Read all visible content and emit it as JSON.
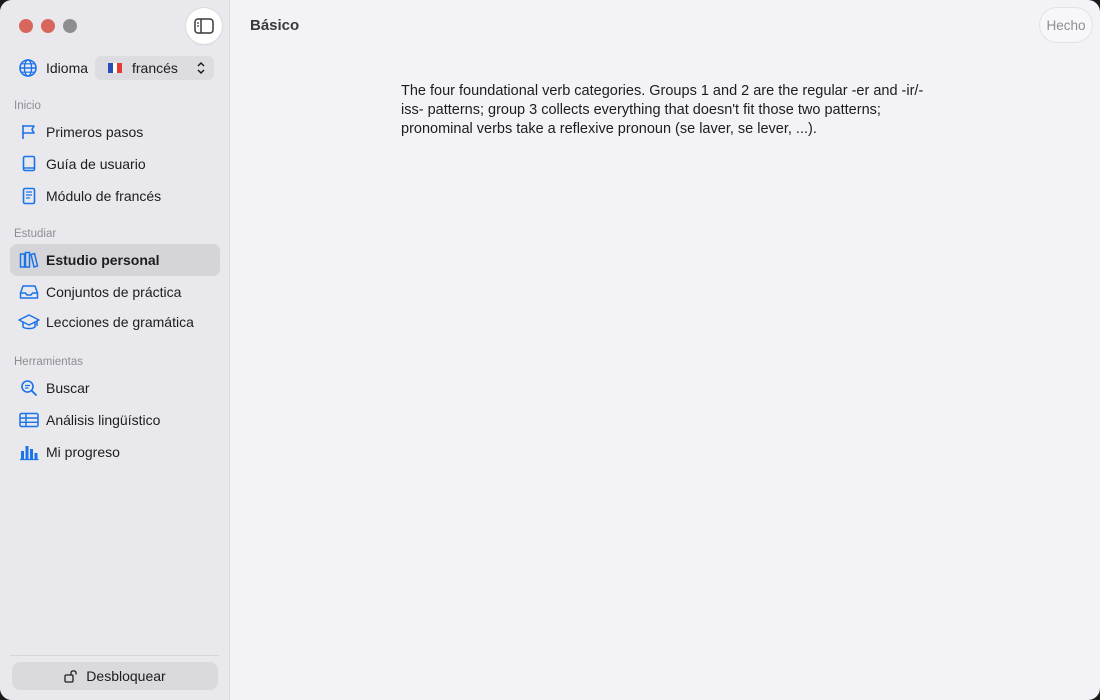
{
  "sidebar": {
    "language_label": "Idioma",
    "language_value": "francés",
    "sections": [
      {
        "title": "Inicio",
        "items": [
          {
            "label": "Primeros pasos",
            "icon": "flag-icon"
          },
          {
            "label": "Guía de usuario",
            "icon": "book-icon"
          },
          {
            "label": "Módulo de francés",
            "icon": "notebook-icon"
          }
        ]
      },
      {
        "title": "Estudiar",
        "items": [
          {
            "label": "Estudio personal",
            "icon": "books-icon",
            "selected": true
          },
          {
            "label": "Conjuntos de práctica",
            "icon": "tray-icon"
          },
          {
            "label": "Lecciones de gramática",
            "icon": "graduation-cap-icon"
          }
        ]
      },
      {
        "title": "Herramientas",
        "items": [
          {
            "label": "Buscar",
            "icon": "search-icon"
          },
          {
            "label": "Análisis lingüístico",
            "icon": "table-icon"
          },
          {
            "label": "Mi progreso",
            "icon": "bar-chart-icon"
          }
        ]
      }
    ],
    "unlock_label": "Desbloquear"
  },
  "main": {
    "title": "Básico",
    "done_label": "Hecho",
    "description": "The four foundational verb categories. Groups 1 and 2 are the regular -er and -ir/-iss- patterns; group 3 collects everything that doesn't fit those two patterns; pronominal verbs take a reflexive pronoun (se laver, se lever, ...)."
  },
  "colors": {
    "accent": "#1a73e8",
    "sidebar_bg": "#e8e8ed",
    "content_bg": "#f2f2f7",
    "selected_bg": "#d4d4d9"
  }
}
